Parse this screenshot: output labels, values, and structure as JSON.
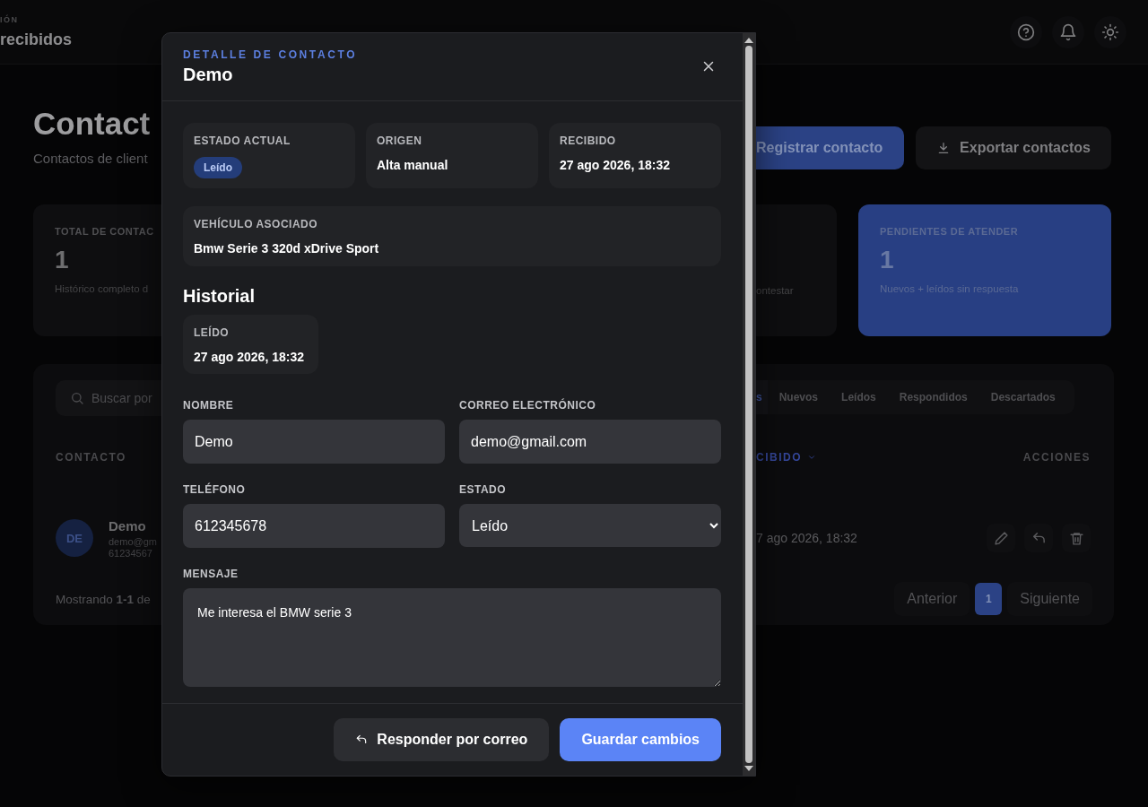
{
  "header": {
    "eyebrow": "IÓN",
    "title": "recibidos"
  },
  "page": {
    "title": "Contact",
    "subtitle": "Contactos de client",
    "actions": [
      {
        "label": "Registrar contacto",
        "kind": "primary"
      },
      {
        "label": "Exportar contactos",
        "kind": "secondary"
      }
    ]
  },
  "stats": [
    {
      "label": "TOTAL DE CONTAC",
      "value": "1",
      "note": "Histórico completo d",
      "kind": "plain"
    },
    {
      "note": "ontestar",
      "kind": "plain"
    },
    {
      "label": "PENDIENTES DE ATENDER",
      "value": "1",
      "note": "Nuevos + leídos sin respuesta",
      "kind": "highlight"
    }
  ],
  "search": {
    "placeholder": "Buscar por"
  },
  "filters": [
    {
      "label": "s",
      "selected": true
    },
    {
      "label": "Nuevos",
      "selected": false
    },
    {
      "label": "Leídos",
      "selected": false
    },
    {
      "label": "Respondidos",
      "selected": false
    },
    {
      "label": "Descartados",
      "selected": false
    }
  ],
  "columns": [
    {
      "label": "CONTACTO",
      "sorted": false
    },
    {
      "label": "CIBIDO",
      "sorted": true
    },
    {
      "label": "ACCIONES",
      "sorted": false
    }
  ],
  "rows": [
    {
      "initials": "DE",
      "name": "Demo",
      "email": "demo@gm",
      "phone": "61234567",
      "received": "7 ago 2026, 18:32"
    }
  ],
  "footer": {
    "summary": "Mostrando **1-1** de",
    "previous": "Anterior",
    "pages": [
      {
        "label": "1",
        "selected": true
      }
    ],
    "next": "Siguiente"
  },
  "modal": {
    "eyebrow": "DETALLE DE CONTACTO",
    "title": "Demo",
    "info": [
      {
        "label": "ESTADO ACTUAL",
        "value": "Leído",
        "kind": "badge"
      },
      {
        "label": "ORIGEN",
        "value": "Alta manual",
        "kind": "text"
      },
      {
        "label": "RECIBIDO",
        "value": "27 ago 2026, 18:32",
        "kind": "text"
      }
    ],
    "vehicle": {
      "label": "VEHÍCULO ASOCIADO",
      "value": "Bmw Serie 3 320d xDrive Sport"
    },
    "history_title": "Historial",
    "history": [
      {
        "label": "LEÍDO",
        "value": "27 ago 2026, 18:32"
      }
    ],
    "fields": [
      {
        "label": "NOMBRE",
        "value": "Demo",
        "kind": "text"
      },
      {
        "label": "CORREO ELECTRÓNICO",
        "value": "demo@gmail.com",
        "kind": "text"
      },
      {
        "label": "TELÉFONO",
        "value": "612345678",
        "kind": "text"
      },
      {
        "label": "ESTADO",
        "value": "Leído",
        "kind": "select"
      },
      {
        "label": "MENSAJE",
        "value": "Me interesa el BMW serie 3",
        "kind": "textarea"
      }
    ],
    "buttons": [
      {
        "label": "Responder por correo",
        "kind": "secondary"
      },
      {
        "label": "Guardar cambios",
        "kind": "primary"
      }
    ]
  }
}
